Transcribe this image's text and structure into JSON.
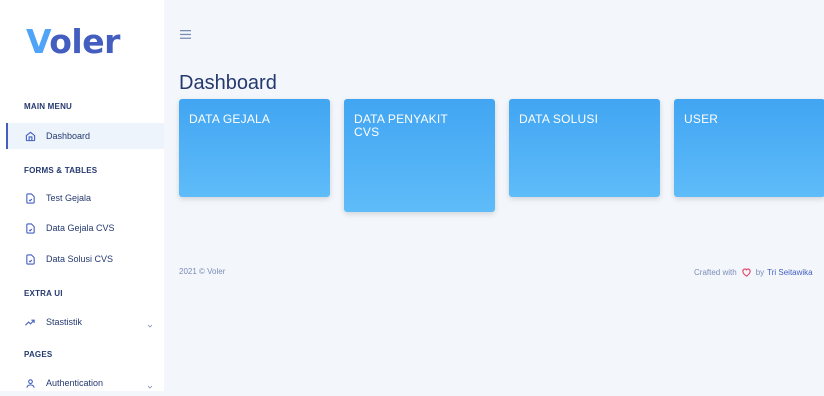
{
  "logo": {
    "first": "V",
    "rest": "oler"
  },
  "sidebar": {
    "main_menu_title": "MAIN MENU",
    "forms_title": "FORMS & TABLES",
    "extra_title": "EXTRA UI",
    "pages_title": "PAGES",
    "items": [
      {
        "label": "Dashboard",
        "icon": "home-icon",
        "active": true
      },
      {
        "label": "Test Gejala",
        "icon": "file-icon"
      },
      {
        "label": "Data Gejala CVS",
        "icon": "file-icon"
      },
      {
        "label": "Data Solusi CVS",
        "icon": "file-icon"
      },
      {
        "label": "Stastistik",
        "icon": "trending-up-icon",
        "has_submenu": true
      },
      {
        "label": "Authentication",
        "icon": "user-icon",
        "has_submenu": true
      }
    ]
  },
  "header": {
    "menu_icon": "hamburger-icon"
  },
  "main": {
    "title": "Dashboard",
    "cards": [
      {
        "label": "DATA GEJALA"
      },
      {
        "label": "DATA PENYAKIT CVS"
      },
      {
        "label": "DATA SOLUSI"
      },
      {
        "label": "USER"
      }
    ]
  },
  "footer": {
    "copyright": "2021 © Voler",
    "crafted_prefix": "Crafted with",
    "crafted_by": "by",
    "author": "Tri Seitawika"
  },
  "colors": {
    "accent": "#435ebe",
    "card": "#4fb0f6",
    "heart": "#e44a6b"
  }
}
